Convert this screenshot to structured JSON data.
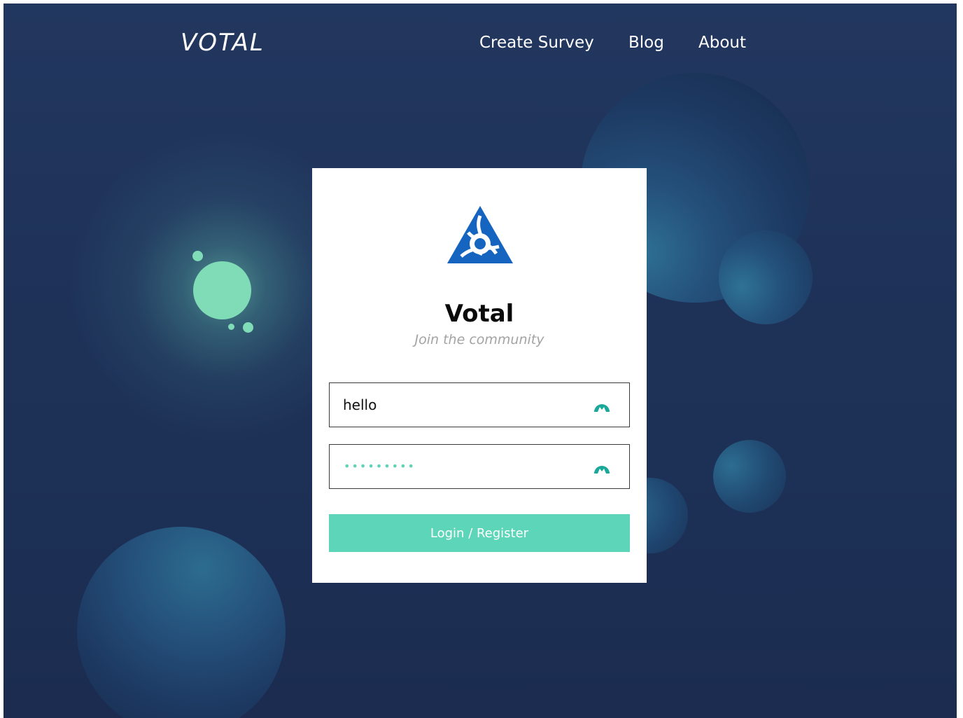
{
  "nav": {
    "brand": "VOTAL",
    "links": [
      "Create Survey",
      "Blog",
      "About"
    ]
  },
  "card": {
    "logo_icon": "votal-triangle-logo-icon",
    "title": "Votal",
    "subtitle": "Join the community",
    "username": {
      "value": "hello",
      "icon": "password-manager-icon"
    },
    "password": {
      "masked_value": "•••••••••",
      "icon": "password-manager-icon"
    },
    "submit_label": "Login / Register"
  },
  "colors": {
    "background": "#1e3258",
    "accent": "#5dd5b8",
    "logo_blue": "#1565c0",
    "orb": "#7fdcb6"
  }
}
